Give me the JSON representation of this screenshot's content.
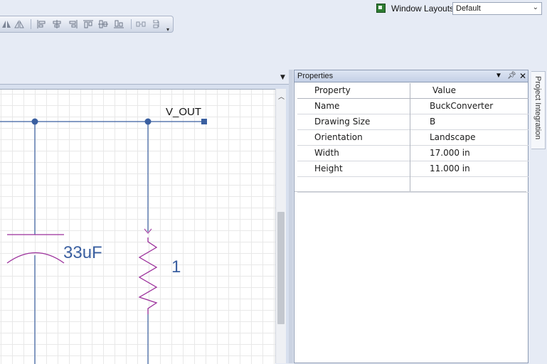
{
  "window_layouts": {
    "label": "Window Layouts:",
    "selected": "Default"
  },
  "toolbar": {
    "icons": [
      "mirror-horizontal-icon",
      "mirror-vertical-icon",
      "align-left-icon",
      "align-center-icon",
      "align-right-icon",
      "align-top-icon",
      "align-middle-icon",
      "align-bottom-icon",
      "distribute-horizontal-icon",
      "distribute-vertical-icon"
    ]
  },
  "schematic": {
    "net_label": "V_OUT",
    "capacitor_value": "33uF",
    "resistor_value": "1"
  },
  "properties": {
    "title": "Properties",
    "columns": {
      "property": "Property",
      "value": "Value"
    },
    "rows": [
      {
        "name": "Name",
        "value": "BuckConverter"
      },
      {
        "name": "Drawing Size",
        "value": "B"
      },
      {
        "name": "Orientation",
        "value": "Landscape"
      },
      {
        "name": "Width",
        "value": "17.000 in"
      },
      {
        "name": "Height",
        "value": "11.000 in"
      }
    ]
  },
  "side_tab": {
    "label": "Project Integration"
  },
  "colors": {
    "wire": "#3a5fa0",
    "component": "#9b2f9b",
    "accent": "#2e7d32"
  }
}
